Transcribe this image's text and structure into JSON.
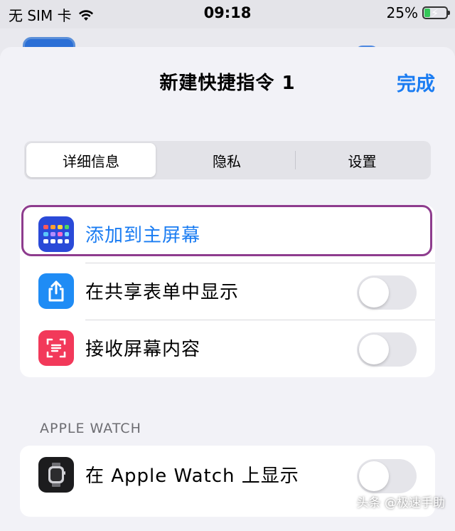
{
  "status_bar": {
    "carrier": "无 SIM 卡",
    "time": "09:18",
    "battery_percent": "25%",
    "battery_level": 0.25,
    "icons": [
      "wifi-icon",
      "battery-charging-icon"
    ]
  },
  "sheet": {
    "title": "新建快捷指令 1",
    "done_label": "完成"
  },
  "tabs": [
    {
      "label": "详细信息",
      "selected": true
    },
    {
      "label": "隐私",
      "selected": false
    },
    {
      "label": "设置",
      "selected": false
    }
  ],
  "actions": {
    "add_to_home": {
      "label": "添加到主屏幕",
      "icon": "home-screen-grid-icon",
      "color": "#1a7cf2"
    },
    "share_sheet": {
      "label": "在共享表单中显示",
      "icon": "share-icon",
      "toggle": false
    },
    "receive_screen": {
      "label": "接收屏幕内容",
      "icon": "screen-scan-icon",
      "toggle": false
    }
  },
  "apple_watch": {
    "header": "APPLE WATCH",
    "show_on_watch": {
      "label": "在 Apple Watch 上显示",
      "icon": "apple-watch-icon",
      "toggle": false
    }
  },
  "watermark": "头条 @极速手助",
  "colors": {
    "accent": "#1a7cf2",
    "highlight": "#8e3c8e",
    "share_bg": "#1f8cf5",
    "scan_bg": "#f2395a"
  }
}
